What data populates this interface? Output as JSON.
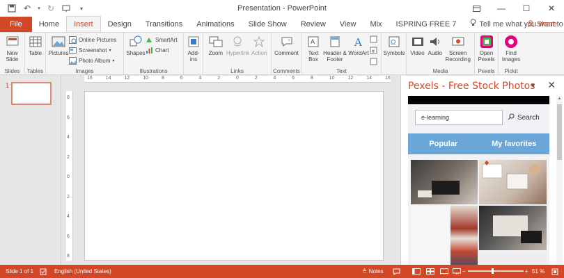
{
  "window": {
    "title": "Presentation  -  PowerPoint"
  },
  "tabs": {
    "file": "File",
    "home": "Home",
    "insert": "Insert",
    "design": "Design",
    "transitions": "Transitions",
    "animations": "Animations",
    "slideshow": "Slide Show",
    "review": "Review",
    "view": "View",
    "mix": "Mix",
    "ispring": "ISPRING FREE 7",
    "tellme": "Tell me what you want to do",
    "share": "Share"
  },
  "ribbon": {
    "new_slide": "New Slide",
    "table": "Table",
    "pictures": "Pictures",
    "online_pictures": "Online Pictures",
    "screenshot": "Screenshot",
    "photo_album": "Photo Album",
    "shapes": "Shapes",
    "smartart": "SmartArt",
    "chart": "Chart",
    "addins": "Add-ins",
    "zoom": "Zoom",
    "hyperlink": "Hyperlink",
    "action": "Action",
    "comment": "Comment",
    "textbox": "Text Box",
    "header_footer": "Header & Footer",
    "wordart": "WordArt",
    "symbols": "Symbols",
    "video": "Video",
    "audio": "Audio",
    "screen_recording": "Screen Recording",
    "open_pexels": "Open Pexels",
    "find_images": "Find Images",
    "groups": {
      "slides": "Slides",
      "tables": "Tables",
      "images": "Images",
      "illustrations": "Illustrations",
      "links": "Links",
      "comments": "Comments",
      "text": "Text",
      "media": "Media",
      "pexels": "Pexels",
      "pickit": "Pickit"
    }
  },
  "thumbs": {
    "number": "1"
  },
  "ruler": {
    "h_ticks": [
      "16",
      "14",
      "12",
      "10",
      "8",
      "6",
      "4",
      "2",
      "0",
      "2",
      "4",
      "6",
      "8",
      "10",
      "12",
      "14",
      "16"
    ],
    "v_ticks": [
      "8",
      "6",
      "4",
      "2",
      "0",
      "2",
      "4",
      "6",
      "8"
    ]
  },
  "pexels": {
    "title": "Pexels - Free Stock Photos",
    "search_value": "e-learning",
    "search_button": "Search",
    "tab_popular": "Popular",
    "tab_favorites": "My favorites"
  },
  "status": {
    "slide": "Slide 1 of 1",
    "language": "English (United States)",
    "notes": "Notes",
    "zoom": "51 %"
  },
  "colors": {
    "accent": "#d24726",
    "pexels_tab": "#6aa6d7"
  }
}
